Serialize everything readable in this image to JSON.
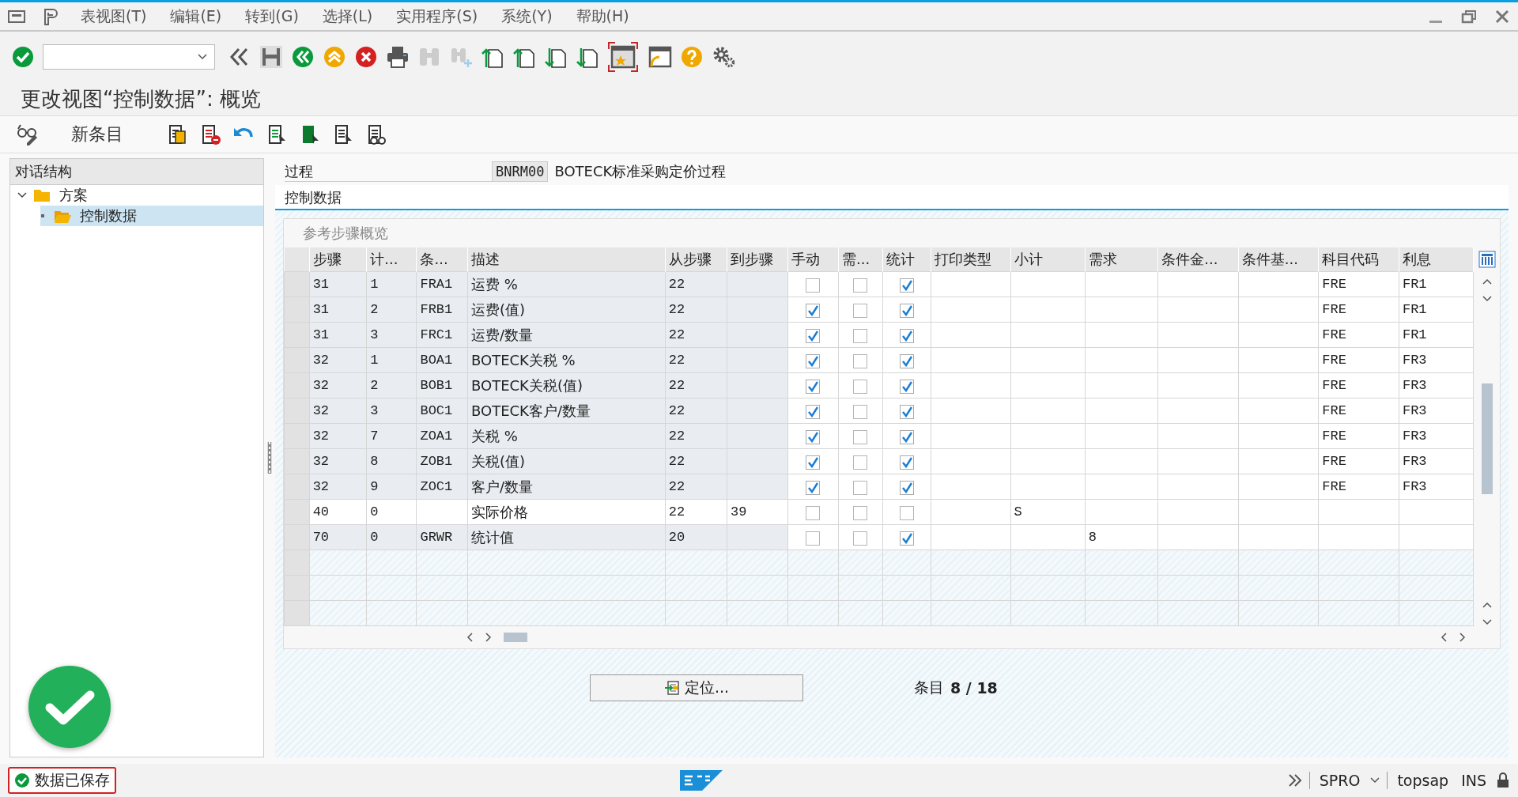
{
  "menu": [
    "表视图(T)",
    "编辑(E)",
    "转到(G)",
    "选择(L)",
    "实用程序(S)",
    "系统(Y)",
    "帮助(H)"
  ],
  "title": "更改视图“控制数据”: 概览",
  "app_toolbar": {
    "new_entries": "新条目"
  },
  "tree": {
    "title": "对话结构",
    "items": [
      {
        "label": "方案",
        "expanded": true,
        "selected": false,
        "children": [
          {
            "label": "控制数据",
            "selected": true
          }
        ]
      }
    ]
  },
  "header_field": {
    "label": "过程",
    "value": "BNRM00",
    "description": "BOTECK标准采购定价过程"
  },
  "tab": "控制数据",
  "table": {
    "title": "参考步骤概览",
    "columns": [
      "步骤",
      "计...",
      "条...",
      "描述",
      "从步骤",
      "到步骤",
      "手动",
      "需...",
      "统计",
      "打印类型",
      "小计",
      "需求",
      "条件金...",
      "条件基...",
      "科目代码",
      "利息"
    ],
    "rows": [
      {
        "step": "31",
        "counter": "1",
        "ctype": "FRA1",
        "description": "运费 %",
        "from": "22",
        "to": "",
        "manual": false,
        "required": false,
        "statistical": true,
        "subtotal": "",
        "requirement": "",
        "account_key": "FRE",
        "accrual": "FR1",
        "input": false
      },
      {
        "step": "31",
        "counter": "2",
        "ctype": "FRB1",
        "description": "运费(值)",
        "from": "22",
        "to": "",
        "manual": true,
        "required": false,
        "statistical": true,
        "subtotal": "",
        "requirement": "",
        "account_key": "FRE",
        "accrual": "FR1",
        "input": false
      },
      {
        "step": "31",
        "counter": "3",
        "ctype": "FRC1",
        "description": "运费/数量",
        "from": "22",
        "to": "",
        "manual": true,
        "required": false,
        "statistical": true,
        "subtotal": "",
        "requirement": "",
        "account_key": "FRE",
        "accrual": "FR1",
        "input": false
      },
      {
        "step": "32",
        "counter": "1",
        "ctype": "BOA1",
        "description": "BOTECK关税 %",
        "from": "22",
        "to": "",
        "manual": true,
        "required": false,
        "statistical": true,
        "subtotal": "",
        "requirement": "",
        "account_key": "FRE",
        "accrual": "FR3",
        "input": false
      },
      {
        "step": "32",
        "counter": "2",
        "ctype": "BOB1",
        "description": "BOTECK关税(值)",
        "from": "22",
        "to": "",
        "manual": true,
        "required": false,
        "statistical": true,
        "subtotal": "",
        "requirement": "",
        "account_key": "FRE",
        "accrual": "FR3",
        "input": false
      },
      {
        "step": "32",
        "counter": "3",
        "ctype": "BOC1",
        "description": "BOTECK客户/数量",
        "from": "22",
        "to": "",
        "manual": true,
        "required": false,
        "statistical": true,
        "subtotal": "",
        "requirement": "",
        "account_key": "FRE",
        "accrual": "FR3",
        "input": false
      },
      {
        "step": "32",
        "counter": "7",
        "ctype": "ZOA1",
        "description": "关税 %",
        "from": "22",
        "to": "",
        "manual": true,
        "required": false,
        "statistical": true,
        "subtotal": "",
        "requirement": "",
        "account_key": "FRE",
        "accrual": "FR3",
        "input": false
      },
      {
        "step": "32",
        "counter": "8",
        "ctype": "ZOB1",
        "description": "关税(值)",
        "from": "22",
        "to": "",
        "manual": true,
        "required": false,
        "statistical": true,
        "subtotal": "",
        "requirement": "",
        "account_key": "FRE",
        "accrual": "FR3",
        "input": false
      },
      {
        "step": "32",
        "counter": "9",
        "ctype": "ZOC1",
        "description": "客户/数量",
        "from": "22",
        "to": "",
        "manual": true,
        "required": false,
        "statistical": true,
        "subtotal": "",
        "requirement": "",
        "account_key": "FRE",
        "accrual": "FR3",
        "input": false
      },
      {
        "step": "40",
        "counter": "0",
        "ctype": "",
        "description": "实际价格",
        "from": "22",
        "to": "39",
        "manual": false,
        "required": false,
        "statistical": false,
        "subtotal": "S",
        "requirement": "",
        "account_key": "",
        "accrual": "",
        "input": true
      },
      {
        "step": "70",
        "counter": "0",
        "ctype": "GRWR",
        "description": "统计值",
        "from": "20",
        "to": "",
        "manual": false,
        "required": false,
        "statistical": true,
        "subtotal": "",
        "requirement": "8",
        "account_key": "",
        "accrual": "",
        "input": false
      }
    ]
  },
  "position_button": "定位...",
  "entry_label": "条目",
  "entry_count": "8 / 18",
  "status_message": "数据已保存",
  "status_bar": {
    "transaction": "SPRO",
    "user": "topsap",
    "mode": "INS"
  }
}
